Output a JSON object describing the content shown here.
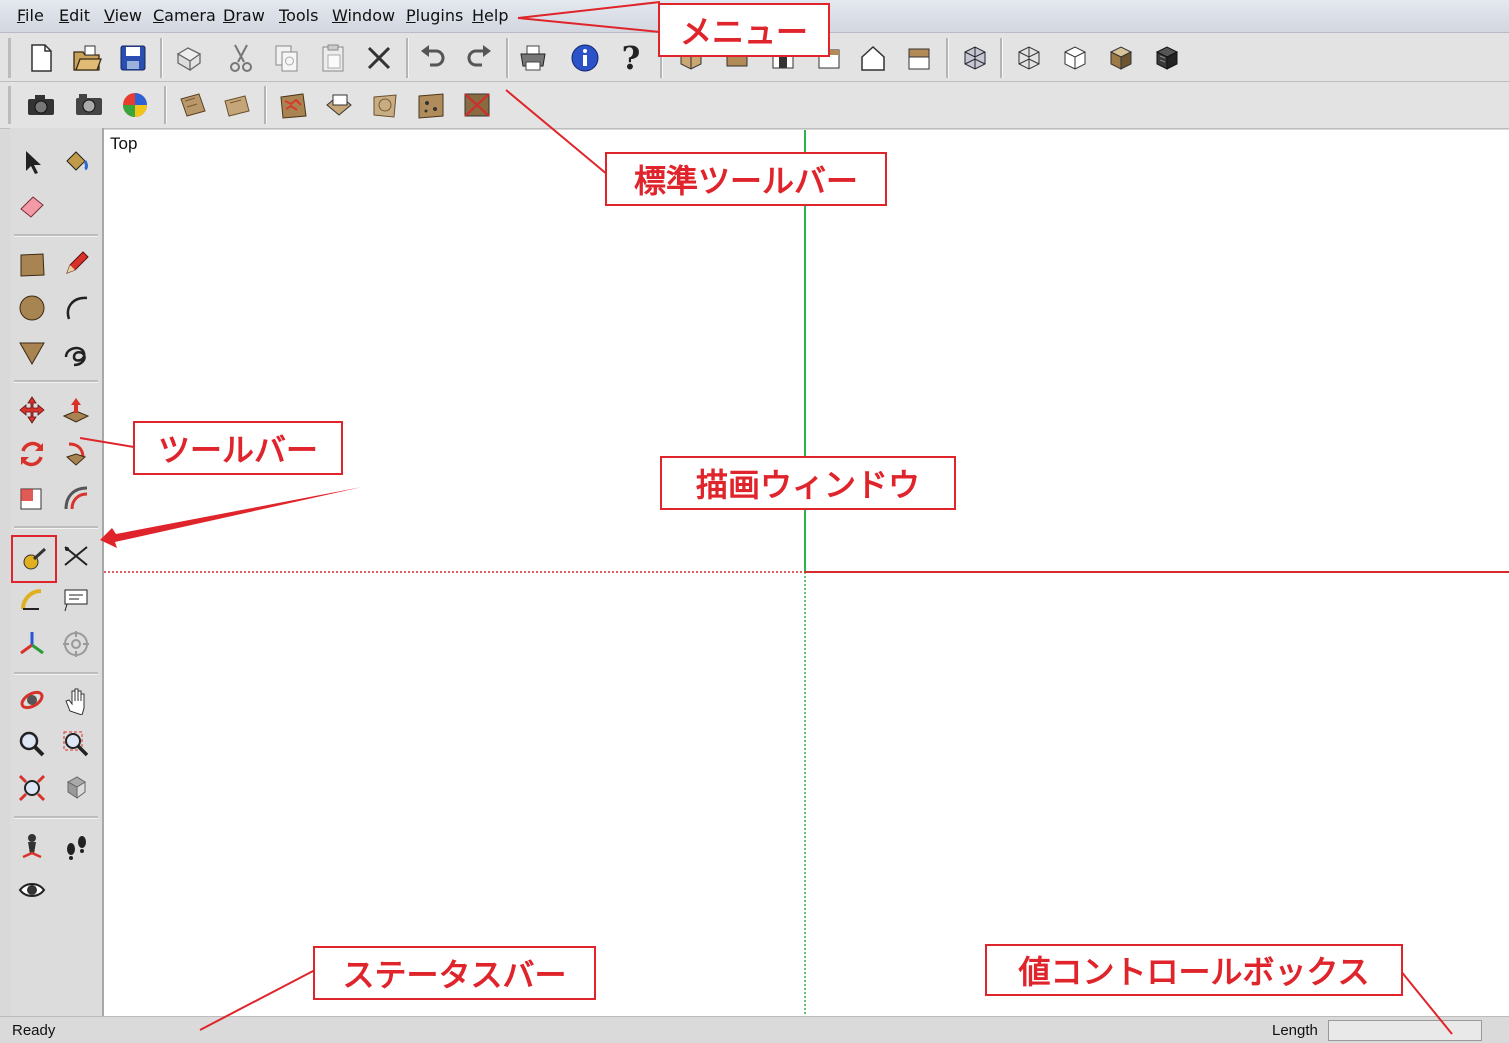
{
  "menu": {
    "items": [
      "File",
      "Edit",
      "View",
      "Camera",
      "Draw",
      "Tools",
      "Window",
      "Plugins",
      "Help"
    ]
  },
  "viewport": {
    "view_label": "Top"
  },
  "status": {
    "text": "Ready",
    "vcb_label": "Length",
    "vcb_value": ""
  },
  "annotations": {
    "menu": "メニュー",
    "standard_toolbar": "標準ツールバー",
    "toolbar": "ツールバー",
    "drawing_window": "描画ウィンドウ",
    "status_bar": "ステータスバー",
    "value_control_box": "値コントロールボックス"
  },
  "colors": {
    "annotation_red": "#e0242b",
    "axis_green": "#2db34a",
    "axis_red": "#d42a2a",
    "material_tan": "#b8976a"
  },
  "toolbar_icons": {
    "row1": [
      "new-icon",
      "open-icon",
      "save-icon",
      "make-component-icon",
      "cut-icon",
      "copy-icon",
      "paste-icon",
      "erase-icon",
      "undo-icon",
      "redo-icon",
      "print-icon",
      "model-info-icon",
      "help-icon",
      "iso-view-icon",
      "top-view-icon",
      "front-view-icon",
      "right-view-icon",
      "back-view-icon",
      "left-view-icon",
      "xray-icon",
      "wireframe-icon",
      "hidden-line-icon",
      "shaded-icon",
      "shaded-textures-icon"
    ],
    "row2": [
      "camera-icon",
      "photo-camera-icon",
      "components-icon",
      "section-plane-icon",
      "section-display-icon",
      "sandbox-from-contours-icon",
      "sandbox-scratch-icon",
      "smoove-icon",
      "stamp-icon",
      "drape-icon",
      "flip-edge-icon"
    ]
  },
  "left_tools": [
    "select-icon",
    "paint-bucket-icon",
    "eraser-icon",
    "rectangle-icon",
    "pencil-icon",
    "circle-icon",
    "arc-icon",
    "polygon-icon",
    "freehand-icon",
    "move-icon",
    "push-pull-icon",
    "rotate-icon",
    "follow-me-icon",
    "scale-icon",
    "offset-icon",
    "tape-measure-icon",
    "dimension-icon",
    "protractor-icon",
    "text-icon",
    "axes-icon",
    "3d-text-icon",
    "orbit-icon",
    "pan-icon",
    "zoom-icon",
    "zoom-window-icon",
    "zoom-extents-icon",
    "previous-view-icon",
    "position-camera-icon",
    "walk-icon",
    "look-around-icon"
  ]
}
